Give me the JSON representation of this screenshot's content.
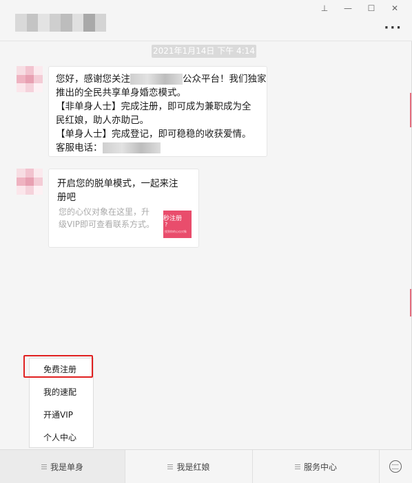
{
  "window": {
    "controls": {
      "pin": "⊥",
      "minimize": "—",
      "maximize": "☐",
      "close": "✕"
    },
    "more": "···"
  },
  "chat": {
    "timestamp": "2021年1月14日 下午 4:14",
    "message1": {
      "line1_pre": "您好，感谢您关注",
      "line1_post": "公众平台！我们独家",
      "line2": "推出的全民共享单身婚恋模式。",
      "line3": "【非单身人士】完成注册，即可成为兼职成为全",
      "line4": "民红娘，助人亦助己。",
      "line5": "【单身人士】完成登记，即可稳稳的收获爱情。",
      "line6": "客服电话："
    },
    "card": {
      "title": "开启您的脱单模式，一起来注册吧",
      "desc": "您的心仪对象在这里，升级VIP即可查看联系方式。",
      "thumb_line1": "秒注册",
      "thumb_line2": "?",
      "thumb_line3": "找到你的心仪对象"
    }
  },
  "popup": {
    "items": [
      "免费注册",
      "我的速配",
      "开通VIP",
      "个人中心"
    ]
  },
  "bottom_menu": {
    "tabs": [
      "我是单身",
      "我是红娘",
      "服务中心"
    ]
  },
  "colors": {
    "accent_red": "#e02020",
    "thumb_pink": "#e94d6c"
  }
}
